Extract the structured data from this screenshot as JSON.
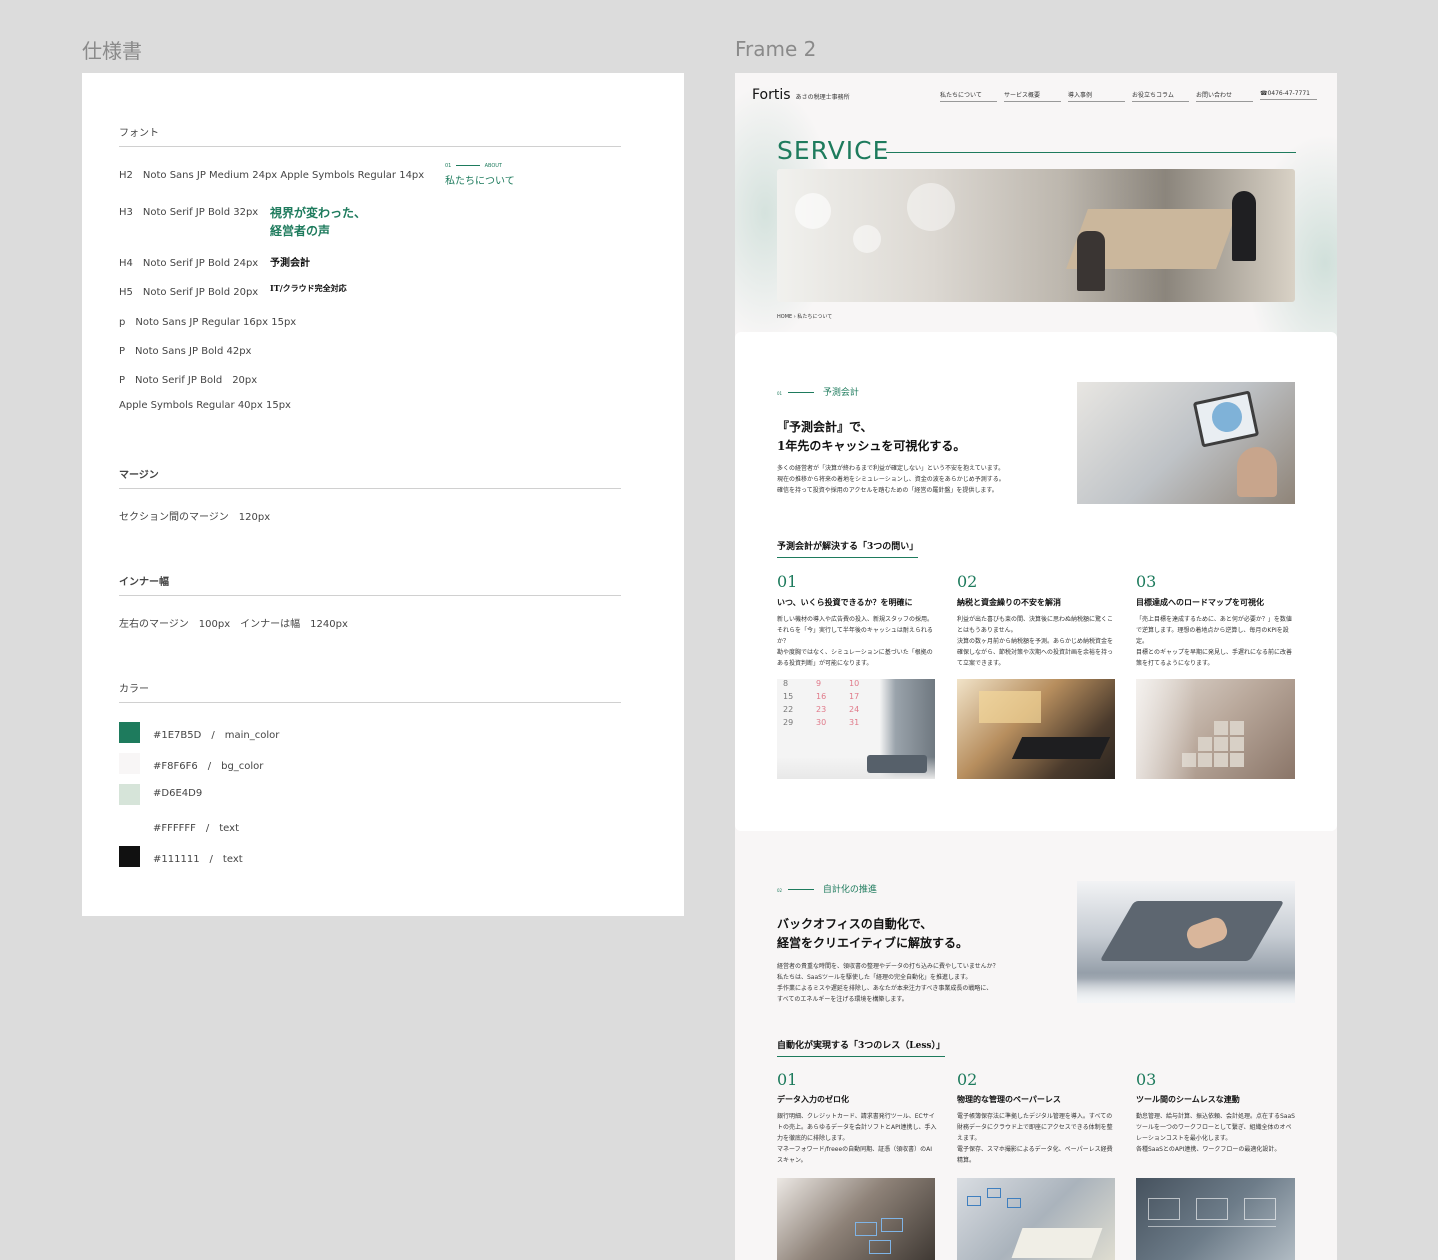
{
  "frames": {
    "spec_title": "仕様書",
    "frame_title": "Frame 2"
  },
  "spec": {
    "font_heading": "フォント",
    "fonts": [
      {
        "label": "H2　Noto Sans JP Medium  24px   Apple Symbols Regular  14px",
        "sample_num": "01",
        "sample_en": "ABOUT",
        "sample": "私たちについて"
      },
      {
        "label": "H3　Noto Serif JP Bold 32px",
        "sample_line1": "視界が変わった、",
        "sample_line2": "経営者の声"
      },
      {
        "label": "H4　Noto Serif JP Bold 24px",
        "sample": "予測会計"
      },
      {
        "label": "H5　Noto Serif JP Bold 20px",
        "sample": "IT/クラウド完全対応"
      },
      {
        "label": "p　Noto Sans JP Regular 16px  15px"
      },
      {
        "label": "P　Noto Sans JP Bold  42px"
      },
      {
        "label": "P　Noto Serif JP Bold　20px"
      },
      {
        "label": "Apple Symbols Regular 40px  15px"
      }
    ],
    "margin_heading": "マージン",
    "margin_text": "セクション間のマージン　120px",
    "inner_heading": "インナー幅",
    "inner_text": "左右のマージン　100px　インナーは幅　1240px",
    "color_heading": "カラー",
    "colors": [
      {
        "hex": "#1E7B5D",
        "label": "#1E7B5D　/　main_color"
      },
      {
        "hex": "#F8F6F6",
        "label": "#F8F6F6　/　bg_color"
      },
      {
        "hex": "#D6E4D9",
        "label": "#D6E4D9"
      },
      {
        "hex": "#FFFFFF",
        "label": "#FFFFFF　/　text"
      },
      {
        "hex": "#111111",
        "label": "#111111　/　text"
      }
    ]
  },
  "site": {
    "logo": "Fortis",
    "logo_sub": "あさの税理士事務所",
    "nav": [
      "私たちについて",
      "サービス概要",
      "導入事例",
      "お役立ちコラム",
      "お問い合わせ"
    ],
    "phone": "0476-47-7771",
    "hero_title": "SERVICE",
    "breadcrumb_home": "HOME",
    "breadcrumb_current": "私たちについて",
    "section1": {
      "num": "01",
      "label": "予測会計",
      "heading_line1": "『予測会計』で、",
      "heading_line2": "1年先のキャッシュを可視化する。",
      "body": "多くの経営者が「決算が終わるまで利益が確定しない」という不安を抱えています。\n現在の推移から将来の着地をシミュレーションし、資金の波をあらかじめ予測する。\n確信を持って投資や採用のアクセルを踏むための「経営の羅針盤」を提供します。",
      "sub_heading": "予測会計が解決する「3つの問い」",
      "cards": [
        {
          "num": "01",
          "title": "いつ、いくら投資できるか？を明確に",
          "body": "新しい機材の導入や広告費の投入、新規スタッフの採用。それらを「今」実行して半年後のキャッシュは耐えられるか？\n勘や度胸ではなく、シミュレーションに基づいた「根拠のある投資判断」が可能になります。"
        },
        {
          "num": "02",
          "title": "納税と資金繰りの不安を解消",
          "body": "利益が出た喜びも束の間、決算後に思わぬ納税額に驚くことはもうありません。\n決算の数ヶ月前から納税額を予測。あらかじめ納税資金を確保しながら、節税対策や次期への投資計画を余裕を持って立案できます。"
        },
        {
          "num": "03",
          "title": "目標達成へのロードマップを可視化",
          "body": "「売上目標を達成するために、あと何が必要か？」を数値で逆算します。理想の着地点から逆算し、毎月のKPIを設定。\n目標とのギャップを早期に発見し、手遅れになる前に改善策を打てるようになります。"
        }
      ],
      "calendar": [
        "8",
        "9",
        "10",
        "15",
        "16",
        "17",
        "22",
        "23",
        "24",
        "29",
        "30",
        "31"
      ]
    },
    "section2": {
      "num": "02",
      "label": "自計化の推進",
      "heading_line1": "バックオフィスの自動化で、",
      "heading_line2": "経営をクリエイティブに解放する。",
      "body": "経営者の貴重な時間を、領収書の整理やデータの打ち込みに費やしていませんか？\n私たちは、SaaSツールを駆使した「経理の完全自動化」を推進します。\n手作業によるミスや遅延を排除し、あなたが本来注力すべき事業成長の戦略に、\nすべてのエネルギーを注げる環境を構築します。",
      "sub_heading": "自動化が実現する「3つのレス（Less）」",
      "cards": [
        {
          "num": "01",
          "title": "データ入力のゼロ化",
          "body": "銀行明細、クレジットカード、請求書発行ツール、ECサイトの売上。あらゆるデータを会計ソフトとAPI連携し、手入力を徹底的に排除します。\nマネーフォワード/freeeの自動同期、証憑（領収書）のAIスキャン。"
        },
        {
          "num": "02",
          "title": "物理的な管理のペーパーレス",
          "body": "電子帳簿保存法に準拠したデジタル管理を導入。すべての財務データにクラウド上で即座にアクセスできる体制を整えます。\n電子保存、スマホ撮影によるデータ化、ペーパーレス経費精算。"
        },
        {
          "num": "03",
          "title": "ツール間のシームレスな連動",
          "body": "勤怠管理、給与計算、振込依頼、会計処理。点在するSaaSツールを一つのワークフローとして繋ぎ、組織全体のオペレーションコストを最小化します。\n各種SaaSとのAPI連携、ワークフローの最適化設計。"
        }
      ]
    }
  }
}
